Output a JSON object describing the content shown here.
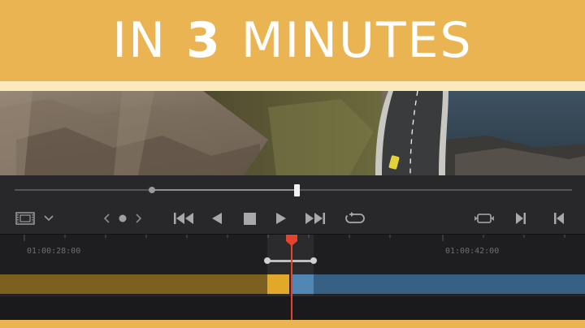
{
  "banner": {
    "word1": "IN",
    "highlight": "3",
    "word2": "MINUTES",
    "bg_color": "#eab452",
    "text_color": "#ffffff"
  },
  "viewer": {
    "scrubber_position": 0.51
  },
  "transport": {
    "icons": [
      "film-strip-icon",
      "chevron-down-icon",
      "prev-edit-icon",
      "marker-dot-icon",
      "next-edit-icon",
      "jump-to-start-icon",
      "play-reverse-icon",
      "stop-icon",
      "play-icon",
      "jump-to-end-icon",
      "loop-icon",
      "match-frame-icon",
      "mark-out-icon",
      "mark-in-icon"
    ]
  },
  "timeline": {
    "timecodes": [
      "01:00:28:00",
      "01:00:42:00"
    ],
    "colors": {
      "playhead": "#e2442f",
      "clip_gold": "#e2a82a",
      "clip_blue": "#4f86b4"
    }
  }
}
